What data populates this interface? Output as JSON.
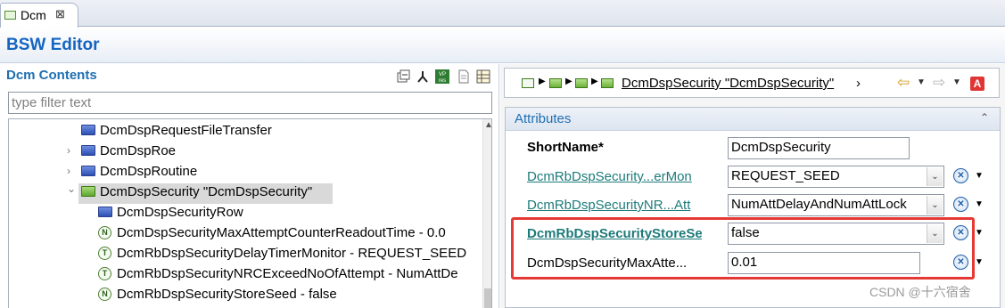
{
  "editor_tab": {
    "label": "Dcm",
    "close": "⊠"
  },
  "editor_title": "BSW Editor",
  "left_panel": {
    "title": "Dcm Contents",
    "filter_placeholder": "type filter text",
    "tree": [
      {
        "label": "DcmDspRequestFileTransfer",
        "icon": "blue-folder-icon",
        "twisty": ""
      },
      {
        "label": "DcmDspRoe",
        "icon": "blue-folder-icon",
        "twisty": "›"
      },
      {
        "label": "DcmDspRoutine",
        "icon": "blue-folder-icon",
        "twisty": "›"
      },
      {
        "label": "DcmDspSecurity \"DcmDspSecurity\"",
        "icon": "green-folder-icon",
        "twisty": "⌄"
      },
      {
        "label": "DcmDspSecurityRow",
        "icon": "blue-folder-icon"
      },
      {
        "label": "DcmDspSecurityMaxAttemptCounterReadoutTime - 0.0",
        "icon": "numeric-param-icon",
        "glyph": "N"
      },
      {
        "label": "DcmRbDspSecurityDelayTimerMonitor - REQUEST_SEED",
        "icon": "text-param-icon",
        "glyph": "T"
      },
      {
        "label": "DcmRbDspSecurityNRCExceedNoOfAttempt - NumAttDe",
        "icon": "text-param-icon",
        "glyph": "T"
      },
      {
        "label": "DcmRbDspSecurityStoreSeed - false",
        "icon": "numeric-param-icon",
        "glyph": "N"
      }
    ]
  },
  "breadcrumb": {
    "label": "DcmDspSecurity \"DcmDspSecurity\"",
    "more": "›"
  },
  "attributes": {
    "title": "Attributes",
    "collapse": "⌃",
    "rows": [
      {
        "label": "ShortName*",
        "value": "DcmDspSecurity",
        "kind": "text"
      },
      {
        "label": "DcmRbDspSecurity...erMon",
        "value": "REQUEST_SEED",
        "kind": "combo"
      },
      {
        "label": "DcmRbDspSecurityNR...Att",
        "value": "NumAttDelayAndNumAttLock",
        "kind": "combo"
      },
      {
        "label": "DcmRbDspSecurityStoreSe",
        "value": "false",
        "kind": "combo"
      },
      {
        "label": "DcmDspSecurityMaxAtte...",
        "value": "0.01",
        "kind": "text"
      }
    ]
  },
  "watermark": "CSDN @十六宿舍",
  "colors": {
    "accent": "#1565c0",
    "link": "#1e7a7a",
    "highlight": "#e53935"
  }
}
